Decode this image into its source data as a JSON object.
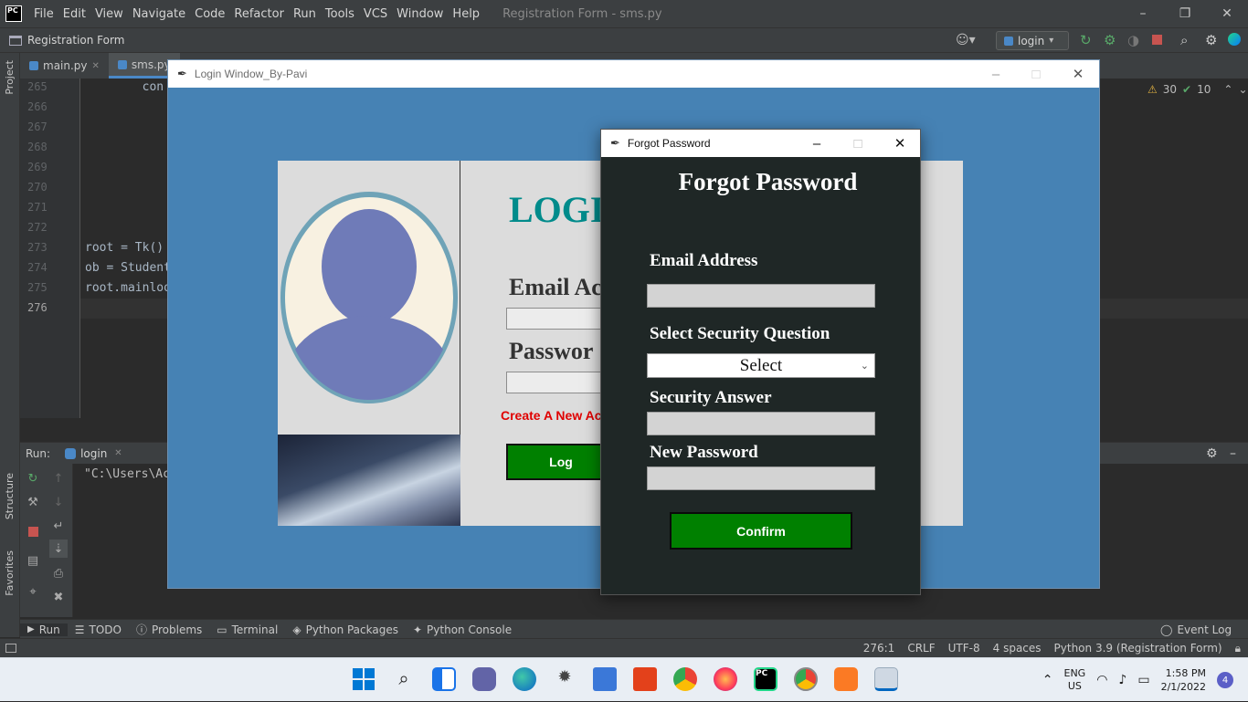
{
  "ide": {
    "logo": "PC",
    "menu": [
      "File",
      "Edit",
      "View",
      "Navigate",
      "Code",
      "Refactor",
      "Run",
      "Tools",
      "VCS",
      "Window",
      "Help"
    ],
    "title": "Registration Form - sms.py",
    "project_name": "Registration Form",
    "run_config": "login",
    "tabs": [
      {
        "label": "main.py"
      },
      {
        "label": "sms.py"
      }
    ],
    "inspection": {
      "warnings": "30",
      "ok": "10"
    },
    "side_labels": {
      "project": "Project",
      "structure": "Structure",
      "favorites": "Favorites"
    },
    "line_numbers": [
      "265",
      "266",
      "267",
      "268",
      "269",
      "270",
      "271",
      "272",
      "273",
      "274",
      "275",
      "276"
    ],
    "code_lines": [
      "        con",
      "",
      "",
      "",
      "",
      "",
      "",
      "",
      "root = Tk()",
      "ob = Student",
      "root.mainloo",
      ""
    ],
    "run_label": "Run:",
    "run_tab": "login",
    "run_output": "\"C:\\Users\\Ac",
    "bottom_tabs": [
      "Run",
      "TODO",
      "Problems",
      "Terminal",
      "Python Packages",
      "Python Console"
    ],
    "event_log": "Event Log",
    "status": {
      "position": "276:1",
      "line_ending": "CRLF",
      "encoding": "UTF-8",
      "indent": "4 spaces",
      "interpreter": "Python 3.9 (Registration Form)"
    }
  },
  "login_window": {
    "title": "Login Window_By-Pavi",
    "heading": "LOGI",
    "email_label": "Email Ac",
    "password_label": "Passwor",
    "create_link": "Create A New Ac",
    "login_button": "Log"
  },
  "forgot_window": {
    "title": "Forgot Password",
    "heading": "Forgot Password",
    "email_label": "Email Address",
    "question_label": "Select Security Question",
    "question_value": "Select",
    "answer_label": "Security Answer",
    "new_password_label": "New Password",
    "confirm_button": "Confirm"
  },
  "taskbar": {
    "language": "ENG",
    "region": "US",
    "time": "1:58 PM",
    "date": "2/1/2022",
    "notifications": "4"
  },
  "colors": {
    "login_bg": "#4682b4",
    "heading_teal": "#008b8b",
    "button_green": "#008000",
    "link_red": "#e00000",
    "forgot_bg": "#1f2726"
  }
}
